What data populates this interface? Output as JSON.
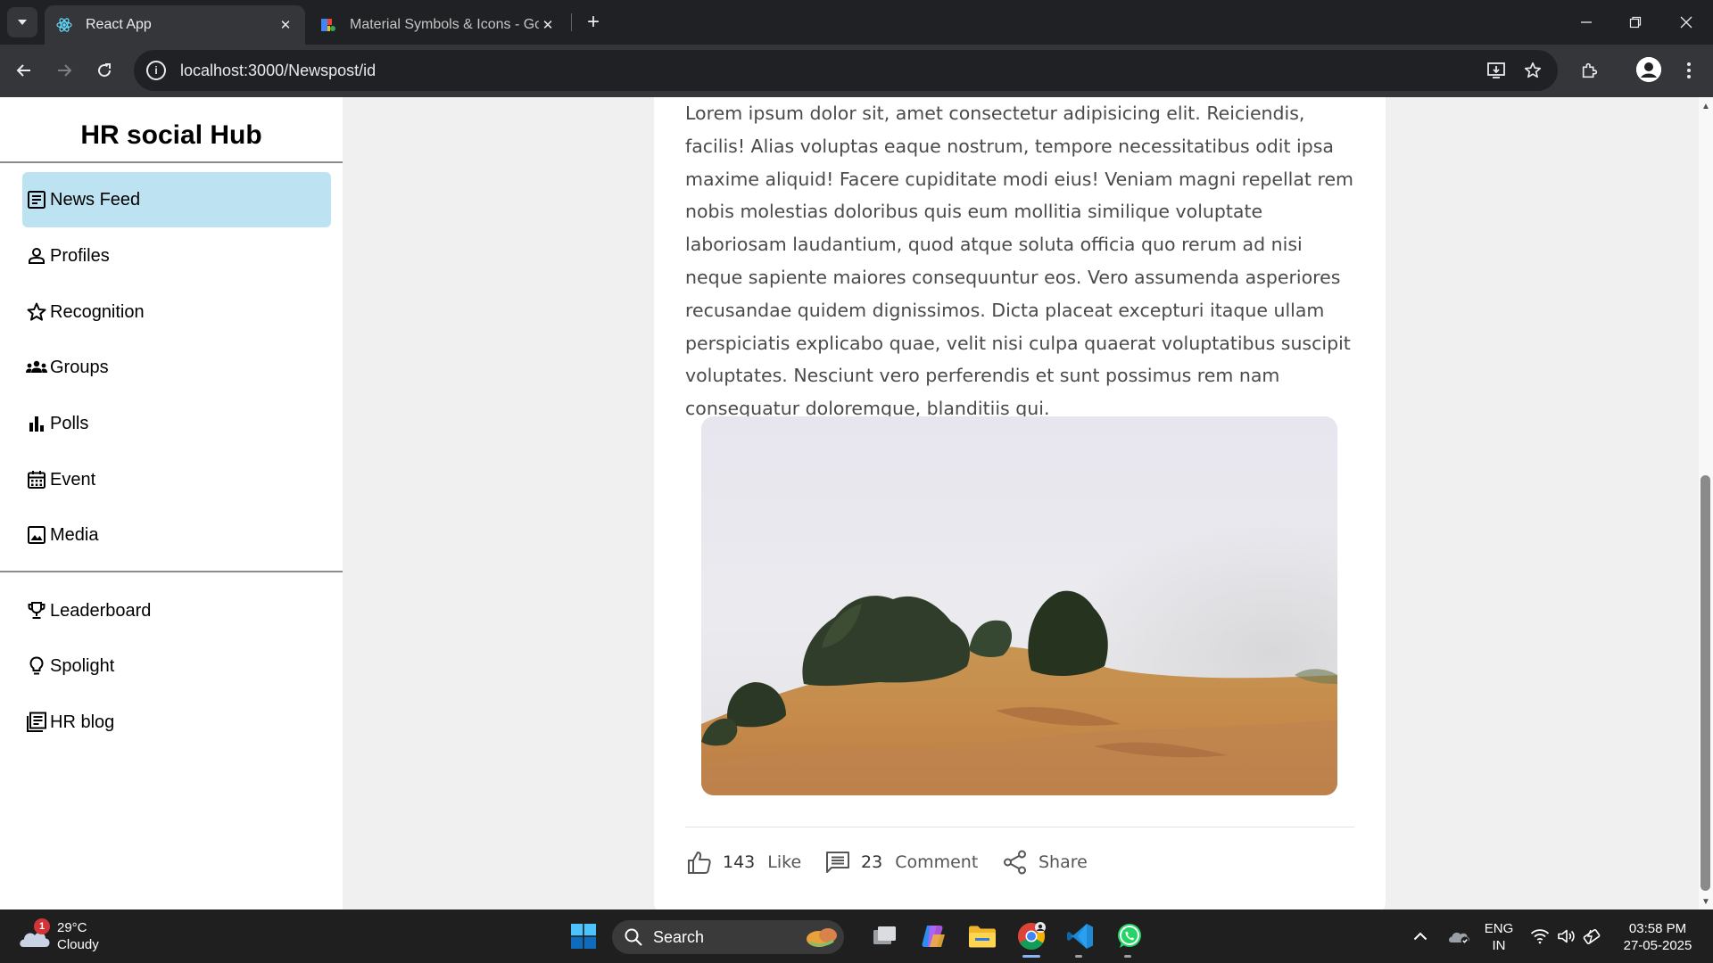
{
  "browser": {
    "tabs": [
      {
        "title": "React App",
        "active": true
      },
      {
        "title": "Material Symbols & Icons - Goo",
        "active": false
      }
    ],
    "url": "localhost:3000/Newspost/id"
  },
  "sidebar": {
    "brand": "HR social Hub",
    "items": [
      {
        "label": "News Feed",
        "icon": "article-icon",
        "active": true
      },
      {
        "label": "Profiles",
        "icon": "person-icon"
      },
      {
        "label": "Recognition",
        "icon": "star-icon"
      },
      {
        "label": "Groups",
        "icon": "groups-icon"
      },
      {
        "label": "Polls",
        "icon": "bar-chart-icon"
      },
      {
        "label": "Event",
        "icon": "calendar-icon"
      },
      {
        "label": "Media",
        "icon": "image-icon"
      }
    ],
    "secondary_items": [
      {
        "label": "Leaderboard",
        "icon": "trophy-icon"
      },
      {
        "label": "Spolight",
        "icon": "lightbulb-icon"
      },
      {
        "label": "HR blog",
        "icon": "newspaper-icon"
      }
    ]
  },
  "post": {
    "body": "Lorem ipsum dolor sit, amet consectetur adipisicing elit. Reiciendis, facilis! Alias voluptas eaque nostrum, tempore necessitatibus odit ipsa maxime aliquid! Facere cupiditate modi eius! Veniam magni repellat rem nobis molestias doloribus quis eum mollitia similique voluptate laboriosam laudantium, quod atque soluta officia quo rerum ad nisi neque sapiente maiores consequuntur eos. Vero assumenda asperiores recusandae quidem dignissimos. Dicta placeat excepturi itaque ullam perspiciatis explicabo quae, velit nisi culpa quaerat voluptatibus suscipit voluptates. Nesciunt vero perferendis et sunt possimus rem nam consequatur doloremque, blanditiis qui.",
    "likes": "143",
    "like_label": "Like",
    "comments": "23",
    "comment_label": "Comment",
    "share_label": "Share"
  },
  "taskbar": {
    "weather_temp": "29°C",
    "weather_desc": "Cloudy",
    "weather_badge": "1",
    "search_placeholder": "Search",
    "lang_top": "ENG",
    "lang_bottom": "IN",
    "time": "03:58 PM",
    "date": "27-05-2025"
  },
  "colors": {
    "active_nav_bg": "#bde3f3",
    "card_bg": "#ffffff",
    "page_bg": "#f0f0f0"
  }
}
